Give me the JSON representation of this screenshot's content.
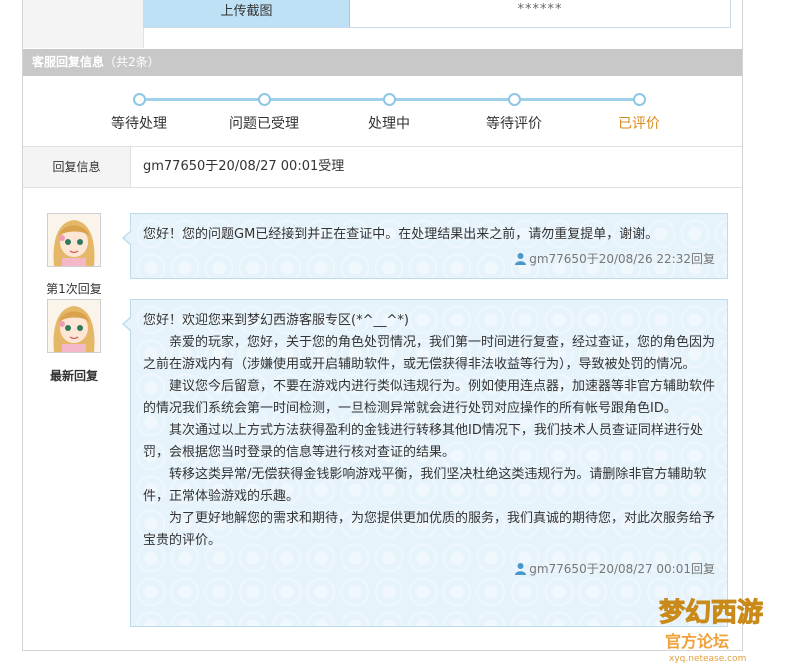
{
  "upload": {
    "button_label": "上传截图",
    "value": "******"
  },
  "section": {
    "title": "客服回复信息",
    "count": "（共2条）"
  },
  "progress": {
    "steps": [
      {
        "label": "等待处理",
        "active": false
      },
      {
        "label": "问题已受理",
        "active": false
      },
      {
        "label": "处理中",
        "active": false
      },
      {
        "label": "等待评价",
        "active": false
      },
      {
        "label": "已评价",
        "active": true
      }
    ],
    "active_color": "#d98a1c",
    "track_color": "#9fd0ec"
  },
  "reply_info": {
    "label": "回复信息",
    "value": "gm77650于20/08/27 00:01受理"
  },
  "replies": [
    {
      "avatar_label": "第1次回复",
      "paragraphs": [
        "您好！您的问题GM已经接到并正在查证中。在处理结果出来之前，请勿重复提单，谢谢。"
      ],
      "meta": "gm77650于20/08/26 22:32回复"
    },
    {
      "avatar_label": "最新回复",
      "paragraphs": [
        "您好！欢迎您来到梦幻西游客服专区(*^__^*)",
        "亲爱的玩家，您好，关于您的角色处罚情况，我们第一时间进行复查，经过查证，您的角色因为之前在游戏内有（涉嫌使用或开启辅助软件，或无偿获得非法收益等行为），导致被处罚的情况。",
        "建议您今后留意，不要在游戏内进行类似违规行为。例如使用连点器，加速器等非官方辅助软件的情况我们系统会第一时间检测，一旦检测异常就会进行处罚对应操作的所有帐号跟角色ID。",
        "其次通过以上方式方法获得盈利的金钱进行转移其他ID情况下，我们技术人员查证同样进行处罚，会根据您当时登录的信息等进行核对查证的结果。",
        "转移这类异常/无偿获得金钱影响游戏平衡，我们坚决杜绝这类违规行为。请删除非官方辅助软件，正常体验游戏的乐趣。",
        "为了更好地解您的需求和期待，为您提供更加优质的服务，我们真诚的期待您，对此次服务给予宝贵的评价。"
      ],
      "meta": "gm77650于20/08/27 00:01回复"
    }
  ],
  "watermark": {
    "line1": "梦幻西游",
    "line2": "官方论坛",
    "url": "xyq.netease.com"
  },
  "colors": {
    "bubble_bg": "#e6f3fb",
    "bubble_border": "#bcdcee",
    "header_bg": "#c8c8c8",
    "upload_btn_bg": "#bfe1f6"
  }
}
